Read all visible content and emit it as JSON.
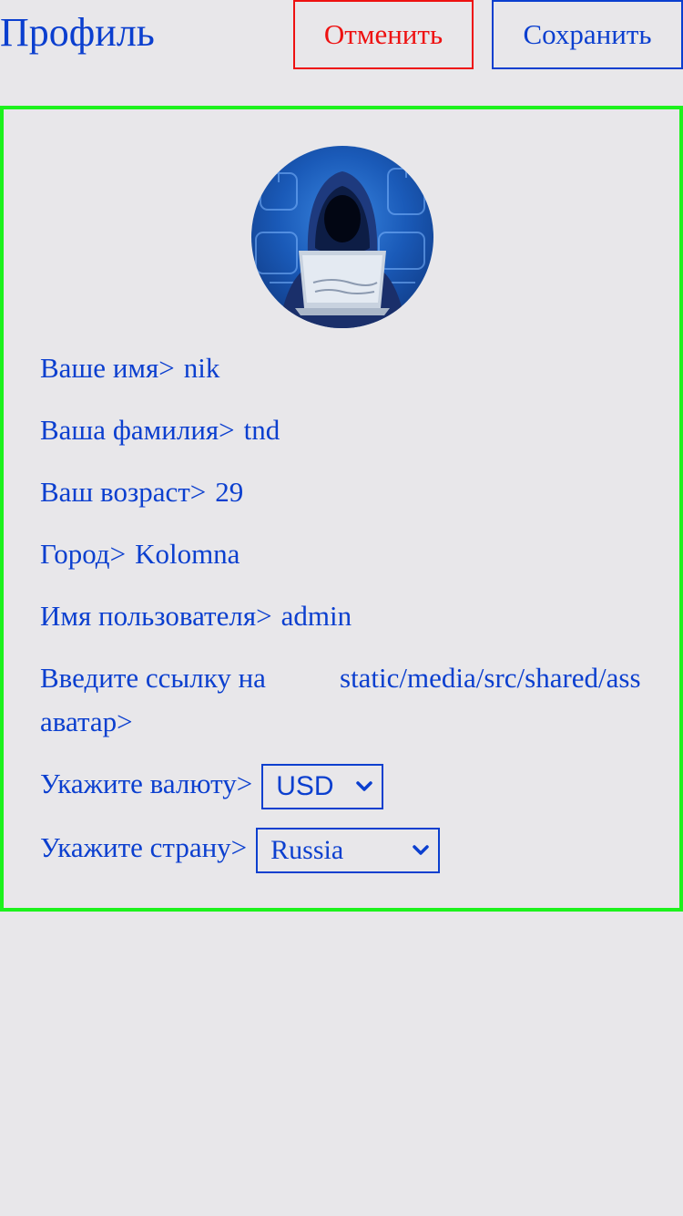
{
  "header": {
    "title": "Профиль",
    "cancel_label": "Отменить",
    "save_label": "Сохранить"
  },
  "profile": {
    "avatar_icon": "hacker-avatar-icon",
    "first_name": {
      "label": "Ваше имя>",
      "value": "nik"
    },
    "last_name": {
      "label": "Ваша фамилия>",
      "value": "tnd"
    },
    "age": {
      "label": "Ваш возраст>",
      "value": "29"
    },
    "city": {
      "label": "Город>",
      "value": "Kolomna"
    },
    "username": {
      "label": "Имя пользователя>",
      "value": "admin"
    },
    "avatar_link": {
      "label": "Введите ссылку на аватар>",
      "value": "static/media/src/shared/ass"
    },
    "currency": {
      "label": "Укажите валюту>",
      "selected": "USD"
    },
    "country": {
      "label": "Укажите страну>",
      "selected": "Russia"
    }
  },
  "colors": {
    "accent": "#0b3fcf",
    "cancel": "#ee1111",
    "card_border": "#1cf21c",
    "background": "#e8e7ea"
  }
}
